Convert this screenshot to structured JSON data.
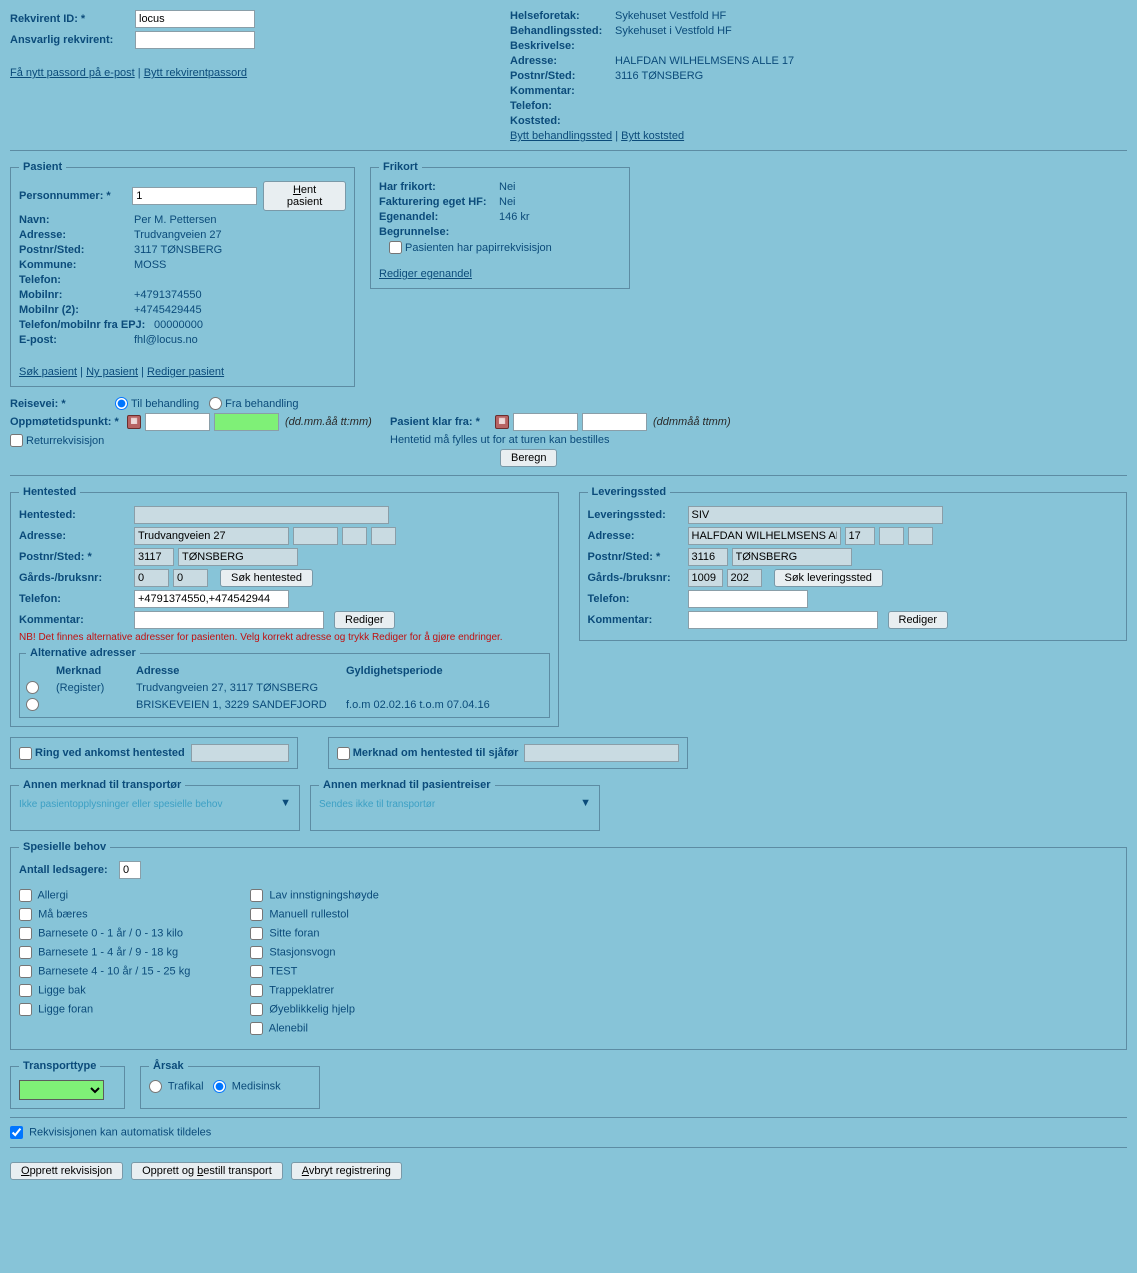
{
  "top": {
    "rekvirent_id_label": "Rekvirent ID: *",
    "rekvirent_id_value": "locus",
    "ansvarlig_label": "Ansvarlig rekvirent:",
    "ansvarlig_value": "",
    "passord_link": "Få nytt passord på e-post",
    "bytt_rekv_link": "Bytt rekvirentpassord",
    "right": {
      "helseforetak_label": "Helseforetak:",
      "helseforetak_value": "Sykehuset Vestfold HF",
      "behandlingssted_label": "Behandlingssted:",
      "behandlingssted_value": "Sykehuset i Vestfold HF",
      "beskrivelse_label": "Beskrivelse:",
      "beskrivelse_value": "",
      "adresse_label": "Adresse:",
      "adresse_value": "HALFDAN WILHELMSENS ALLE 17",
      "postnr_label": "Postnr/Sted:",
      "postnr_value": "3116 TØNSBERG",
      "kommentar_label": "Kommentar:",
      "kommentar_value": "",
      "telefon_label": "Telefon:",
      "telefon_value": "",
      "koststed_label": "Koststed:",
      "koststed_value": "",
      "bytt_beh_link": "Bytt behandlingssted",
      "bytt_kost_link": "Bytt koststed"
    }
  },
  "pasient": {
    "legend": "Pasient",
    "personnr_label": "Personnummer: *",
    "personnr_value": "1",
    "hent_btn": "Hent pasient",
    "navn_label": "Navn:",
    "navn_value": "Per M. Pettersen",
    "adresse_label": "Adresse:",
    "adresse_value": "Trudvangveien 27",
    "postnr_label": "Postnr/Sted:",
    "postnr_value": "3117 TØNSBERG",
    "kommune_label": "Kommune:",
    "kommune_value": "MOSS",
    "telefon_label": "Telefon:",
    "telefon_value": "",
    "mobil_label": "Mobilnr:",
    "mobil_value": "+4791374550",
    "mobil2_label": "Mobilnr (2):",
    "mobil2_value": "+4745429445",
    "epj_label": "Telefon/mobilnr fra EPJ:",
    "epj_value": "00000000",
    "epost_label": "E-post:",
    "epost_value": "fhl@locus.no",
    "sok_link": "Søk pasient",
    "ny_link": "Ny pasient",
    "rediger_link": "Rediger pasient"
  },
  "frikort": {
    "legend": "Frikort",
    "har_label": "Har frikort:",
    "har_value": "Nei",
    "fakt_label": "Fakturering eget HF:",
    "fakt_value": "Nei",
    "egen_label": "Egenandel:",
    "egen_value": "146 kr",
    "begr_label": "Begrunnelse:",
    "papir_label": "Pasienten har papirrekvisisjon",
    "rediger_link": "Rediger egenandel"
  },
  "reisevei": {
    "label": "Reisevei: *",
    "til_label": "Til behandling",
    "fra_label": "Fra behandling",
    "oppmote_label": "Oppmøtetidspunkt: *",
    "hint": "(dd.mm.åå tt:mm)",
    "retur_label": "Returrekvisisjon",
    "klar_label": "Pasient klar fra: *",
    "klar_hint": "(ddmmåå ttmm)",
    "hente_hint": "Hentetid må fylles ut for at turen kan bestilles",
    "beregn_btn": "Beregn"
  },
  "hentested": {
    "legend": "Hentested",
    "hentested_label": "Hentested:",
    "hentested_value": "",
    "adresse_label": "Adresse:",
    "adresse_value": "Trudvangveien 27",
    "nr_value": "",
    "postnr_label": "Postnr/Sted: *",
    "postnr_value": "3117",
    "sted_value": "TØNSBERG",
    "gard_label": "Gårds-/bruksnr:",
    "gard1": "0",
    "gard2": "0",
    "sok_btn": "Søk hentested",
    "tel_label": "Telefon:",
    "tel_value": "+4791374550,+474542944",
    "kom_label": "Kommentar:",
    "kom_value": "",
    "rediger_btn": "Rediger",
    "warn": "NB! Det finnes alternative adresser for pasienten. Velg korrekt adresse og trykk Rediger for å gjøre endringer.",
    "alt_legend": "Alternative adresser",
    "alt_h1": "Merknad",
    "alt_h2": "Adresse",
    "alt_h3": "Gyldighetsperiode",
    "alt_rows": [
      {
        "merknad": "(Register)",
        "adresse": "Trudvangveien 27, 3117 TØNSBERG",
        "periode": ""
      },
      {
        "merknad": "",
        "adresse": "BRISKEVEIEN 1, 3229 SANDEFJORD",
        "periode": "f.o.m 02.02.16  t.o.m 07.04.16"
      }
    ]
  },
  "leveringssted": {
    "legend": "Leveringssted",
    "lever_label": "Leveringssted:",
    "lever_value": "SIV",
    "adresse_label": "Adresse:",
    "adresse_value": "HALFDAN WILHELMSENS ALLE",
    "nr_value": "17",
    "postnr_label": "Postnr/Sted: *",
    "postnr_value": "3116",
    "sted_value": "TØNSBERG",
    "gard_label": "Gårds-/bruksnr:",
    "gard1": "1009",
    "gard2": "202",
    "sok_btn": "Søk leveringssted",
    "tel_label": "Telefon:",
    "tel_value": "",
    "kom_label": "Kommentar:",
    "kom_value": "",
    "rediger_btn": "Rediger"
  },
  "ring": {
    "ring_label": "Ring ved ankomst hentested",
    "merknad_label": "Merknad om hentested til sjåfør"
  },
  "annen_transport": {
    "legend": "Annen merknad til transportør",
    "placeholder": "Ikke pasientopplysninger eller spesielle behov"
  },
  "annen_pasient": {
    "legend": "Annen merknad til pasientreiser",
    "placeholder": "Sendes ikke til transportør"
  },
  "spesielle": {
    "legend": "Spesielle behov",
    "antall_label": "Antall ledsagere:",
    "antall_value": "0",
    "col1": [
      "Allergi",
      "Må bæres",
      "Barnesete 0 - 1 år / 0 - 13 kilo",
      "Barnesete 1 - 4 år / 9 - 18 kg",
      "Barnesete 4 - 10 år / 15 - 25 kg",
      "Ligge bak",
      "Ligge foran"
    ],
    "col2": [
      "Lav innstigningshøyde",
      "Manuell rullestol",
      "Sitte foran",
      "Stasjonsvogn",
      "TEST",
      "Trappeklatrer",
      "Øyeblikkelig hjelp",
      "Alenebil"
    ]
  },
  "transporttype": {
    "legend": "Transporttype"
  },
  "arsak": {
    "legend": "Årsak",
    "trafikal": "Trafikal",
    "medisinsk": "Medisinsk"
  },
  "auto_label": "Rekvisisjonen kan automatisk tildeles",
  "bottom": {
    "opprett": "Opprett rekvisisjon",
    "opprett_bestill": "Opprett og bestill transport",
    "avbryt": "Avbryt registrering"
  }
}
